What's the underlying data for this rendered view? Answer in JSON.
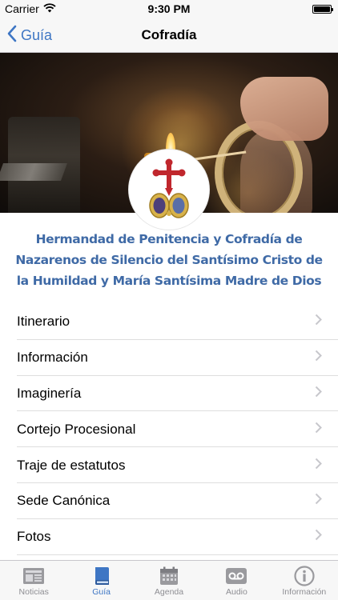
{
  "status_bar": {
    "carrier": "Carrier",
    "time": "9:30 PM"
  },
  "nav": {
    "back_label": "Guía",
    "title": "Cofradía"
  },
  "brotherhood": {
    "name": "Hermandad de Penitencia y Cofradía de Nazarenos de Silencio del Santísimo Cristo de la Humildad y María Santísima Madre de Dios"
  },
  "menu": {
    "items": [
      {
        "label": "Itinerario"
      },
      {
        "label": "Información"
      },
      {
        "label": "Imaginería"
      },
      {
        "label": "Cortejo Procesional"
      },
      {
        "label": "Traje de estatutos"
      },
      {
        "label": "Sede Canónica"
      },
      {
        "label": "Fotos"
      }
    ]
  },
  "tab_bar": {
    "active_color": "#3e76c4",
    "inactive_color": "#8e8e93",
    "tabs": [
      {
        "label": "Noticias",
        "icon": "newspaper-icon",
        "active": false
      },
      {
        "label": "Guía",
        "icon": "book-icon",
        "active": true
      },
      {
        "label": "Agenda",
        "icon": "calendar-icon",
        "active": false
      },
      {
        "label": "Audio",
        "icon": "voicemail-icon",
        "active": false
      },
      {
        "label": "Información",
        "icon": "info-icon",
        "active": false
      }
    ]
  },
  "colors": {
    "accent": "#3e76c4",
    "title_text": "#3f6aa6",
    "emblem_cross": "#c0272d"
  }
}
